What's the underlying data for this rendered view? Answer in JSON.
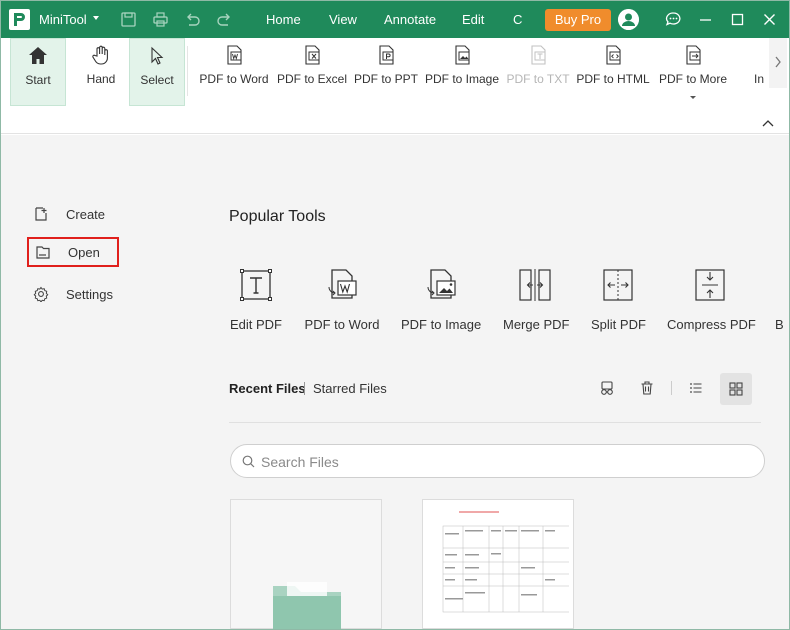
{
  "app": {
    "name": "MiniTool"
  },
  "menu": [
    "Home",
    "View",
    "Annotate",
    "Edit",
    "C"
  ],
  "buy_pro": "Buy Pro",
  "ribbon": {
    "items": [
      {
        "label": "Start",
        "icon": "home-icon",
        "active": true
      },
      {
        "label": "Hand",
        "icon": "hand-icon",
        "active": false
      },
      {
        "label": "Select",
        "icon": "cursor-icon",
        "active": true
      },
      {
        "label": "PDF to Word",
        "icon": "pdf-to-word-icon"
      },
      {
        "label": "PDF to Excel",
        "icon": "pdf-to-excel-icon"
      },
      {
        "label": "PDF to PPT",
        "icon": "pdf-to-ppt-icon"
      },
      {
        "label": "PDF to Image",
        "icon": "pdf-to-image-icon"
      },
      {
        "label": "PDF to TXT",
        "icon": "pdf-to-txt-icon",
        "disabled": true
      },
      {
        "label": "PDF to HTML",
        "icon": "pdf-to-html-icon"
      },
      {
        "label": "PDF to More",
        "icon": "pdf-to-more-icon"
      },
      {
        "label": "In",
        "icon": "import-icon"
      }
    ]
  },
  "sidebar": {
    "items": [
      {
        "label": "Create",
        "icon": "create-icon"
      },
      {
        "label": "Open",
        "icon": "open-folder-icon",
        "highlighted": true
      },
      {
        "label": "Settings",
        "icon": "gear-icon"
      }
    ]
  },
  "popular_tools": {
    "title": "Popular Tools",
    "items": [
      {
        "label": "Edit PDF",
        "icon": "edit-pdf-icon"
      },
      {
        "label": "PDF to Word",
        "icon": "pdf-to-word-icon"
      },
      {
        "label": "PDF to Image",
        "icon": "pdf-to-image-icon"
      },
      {
        "label": "Merge PDF",
        "icon": "merge-pdf-icon"
      },
      {
        "label": "Split PDF",
        "icon": "split-pdf-icon"
      },
      {
        "label": "Compress PDF",
        "icon": "compress-pdf-icon"
      },
      {
        "label": "B",
        "icon": "more-tool-icon"
      }
    ]
  },
  "files": {
    "tabs": {
      "recent": "Recent Files",
      "starred": "Starred Files"
    },
    "search_placeholder": "Search Files"
  },
  "colors": {
    "brand": "#1f8a5b",
    "accent": "#f08c2c",
    "highlight": "#e0201c"
  }
}
